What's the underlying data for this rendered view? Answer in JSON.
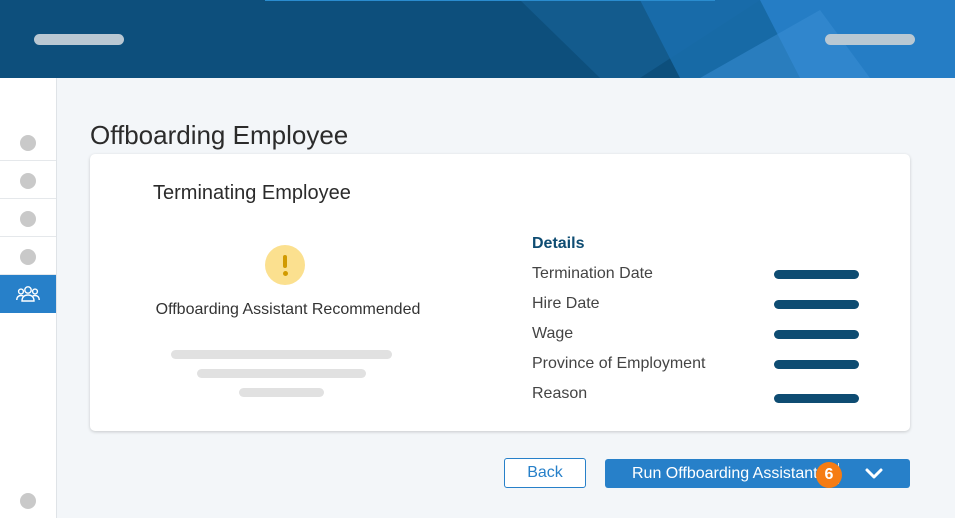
{
  "header": {
    "brand_color": "#0d4f7c",
    "accent_color": "#2780c9"
  },
  "sidebar": {
    "items": [
      {
        "icon": "circle-placeholder-icon"
      },
      {
        "icon": "circle-placeholder-icon"
      },
      {
        "icon": "circle-placeholder-icon"
      },
      {
        "icon": "circle-placeholder-icon"
      },
      {
        "icon": "people-icon",
        "active": true
      }
    ]
  },
  "page": {
    "title": "Offboarding Employee"
  },
  "card": {
    "title": "Terminating Employee",
    "recommendation": {
      "icon": "warning-icon",
      "text": "Offboarding Assistant Recommended"
    },
    "details": {
      "heading": "Details",
      "rows": [
        {
          "label": "Termination Date"
        },
        {
          "label": "Hire Date"
        },
        {
          "label": "Wage"
        },
        {
          "label": "Province of Employment"
        },
        {
          "label": "Reason"
        }
      ]
    }
  },
  "actions": {
    "back_label": "Back",
    "run_label": "Run Offboarding Assistant",
    "step_badge": "6"
  }
}
